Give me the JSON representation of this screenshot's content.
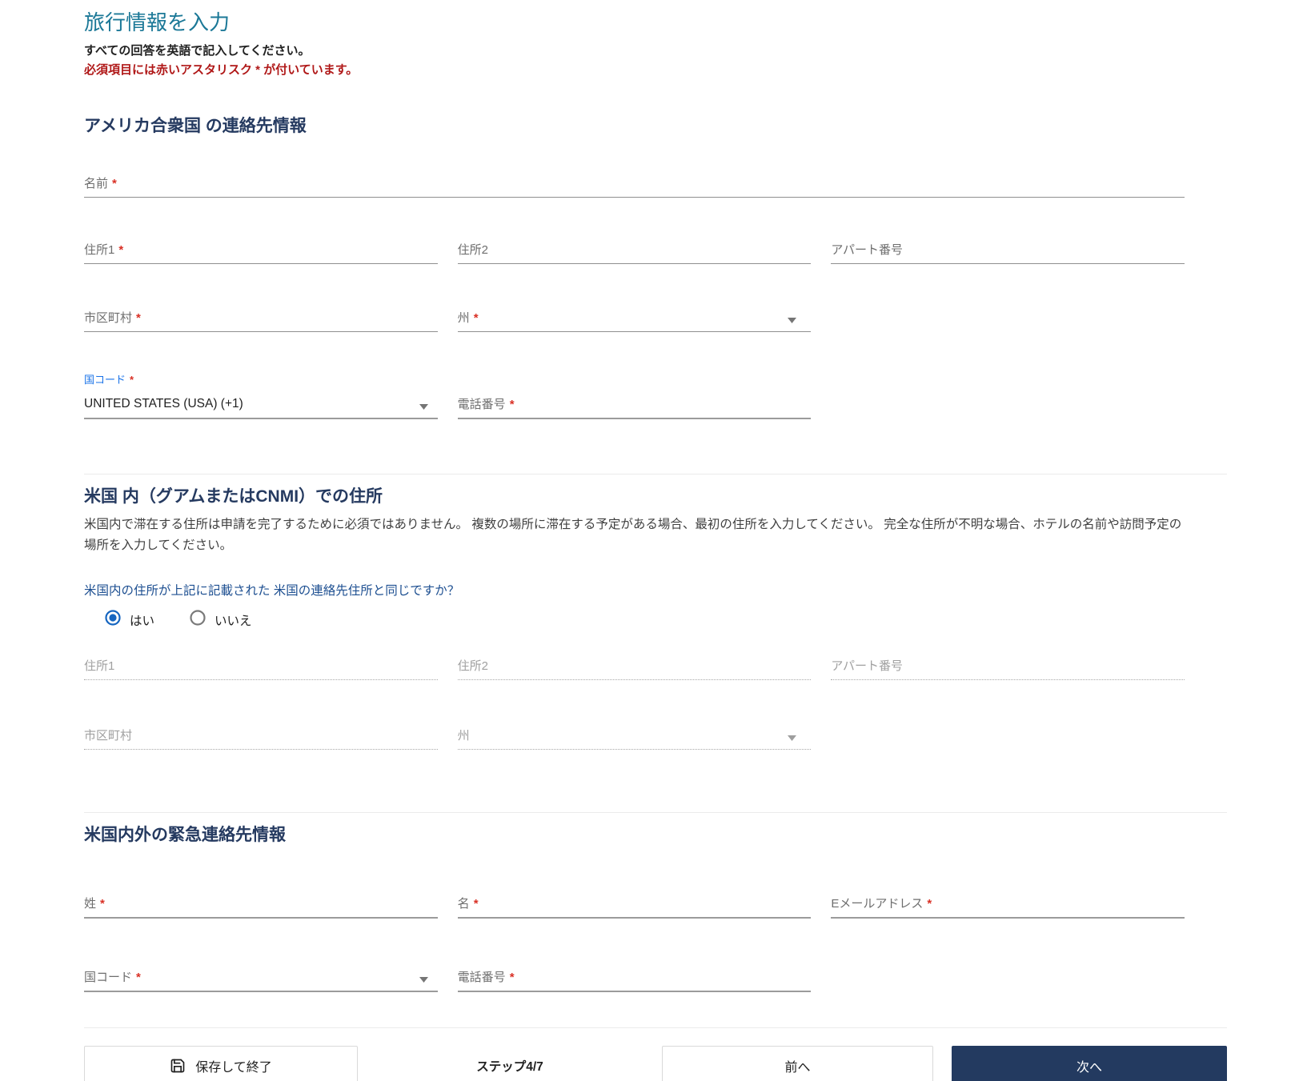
{
  "ui": {
    "required_mark": "*"
  },
  "page": {
    "title": "旅行情報を入力",
    "intro": "すべての回答を英語で記入してください。",
    "required_note": "必須項目には赤いアスタリスク * が付いています。"
  },
  "sections": {
    "us_contact": {
      "heading": "アメリカ合衆国 の連絡先情報",
      "fields": {
        "name": "名前",
        "address1": "住所1",
        "address2": "住所2",
        "apartment": "アパート番号",
        "city": "市区町村",
        "state": "州",
        "country_code_label": "国コード",
        "country_code_value": "UNITED STATES (USA) (+1)",
        "phone": "電話番号"
      }
    },
    "us_address": {
      "heading": "米国 内（グアムまたはCNMI）での住所",
      "description": "米国内で滞在する住所は申請を完了するために必須ではありません。 複数の場所に滞在する予定がある場合、最初の住所を入力してください。 完全な住所が不明な場合、ホテルの名前や訪問予定の場所を入力してください。",
      "question": "米国内の住所が上記に記載された 米国の連絡先住所と同じですか？",
      "radio_yes": "はい",
      "radio_no": "いいえ",
      "fields": {
        "address1": "住所1",
        "address2": "住所2",
        "apartment": "アパート番号",
        "city": "市区町村",
        "state": "州"
      }
    },
    "emergency": {
      "heading": "米国内外の緊急連絡先情報",
      "fields": {
        "last_name": "姓",
        "first_name": "名",
        "email": "Eメールアドレス",
        "country_code": "国コード",
        "phone": "電話番号"
      }
    }
  },
  "footer": {
    "save_exit": "保存して終了",
    "step": "ステップ4/7",
    "prev": "前へ",
    "next": "次へ"
  },
  "colors": {
    "title": "#1b7897",
    "heading": "#253a60",
    "required_note": "#b01818",
    "asterisk": "#d93025",
    "question": "#1d4f91",
    "radio_selected": "#1565c0",
    "next_button": "#233a60"
  }
}
